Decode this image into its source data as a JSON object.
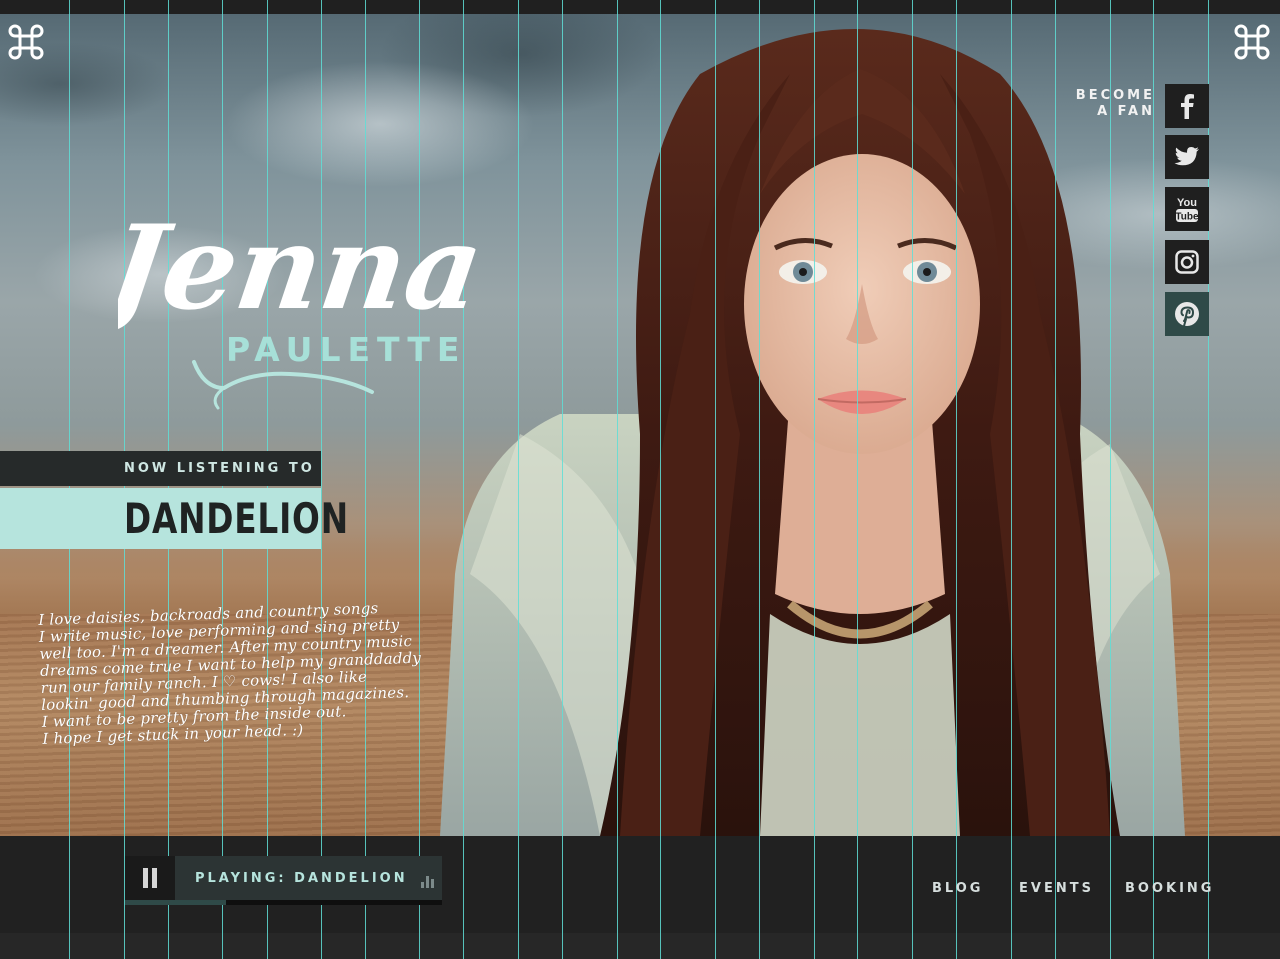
{
  "social": {
    "become_fan_line1": "BECOME",
    "become_fan_line2": "A FAN",
    "icons": [
      "facebook-icon",
      "twitter-icon",
      "youtube-icon",
      "instagram-icon",
      "pinterest-icon"
    ]
  },
  "logo": {
    "script_name": "Jenna",
    "sub_name": "PAULETTE"
  },
  "now_listening": {
    "label": "NOW LISTENING TO",
    "song": "DANDELION"
  },
  "bio": {
    "lines": [
      "I love daisies, backroads and country songs",
      "I write music, love performing and sing pretty",
      "well too. I'm a dreamer. After my country music",
      "dreams come true I want to help my granddaddy",
      "run our family ranch. I ♡ cows! I also like",
      "lookin' good and thumbing through magazines.",
      "I want to be pretty from the inside out.",
      "I hope I get stuck in your head. :)"
    ]
  },
  "player": {
    "playing_text": "PLAYING: DANDELION",
    "progress": 0.32
  },
  "nav": {
    "blog": "BLOG",
    "events": "EVENTS",
    "booking": "BOOKING"
  },
  "colors": {
    "accent": "#b6e4dd",
    "dark": "#212121",
    "guide": "#5fded6"
  }
}
